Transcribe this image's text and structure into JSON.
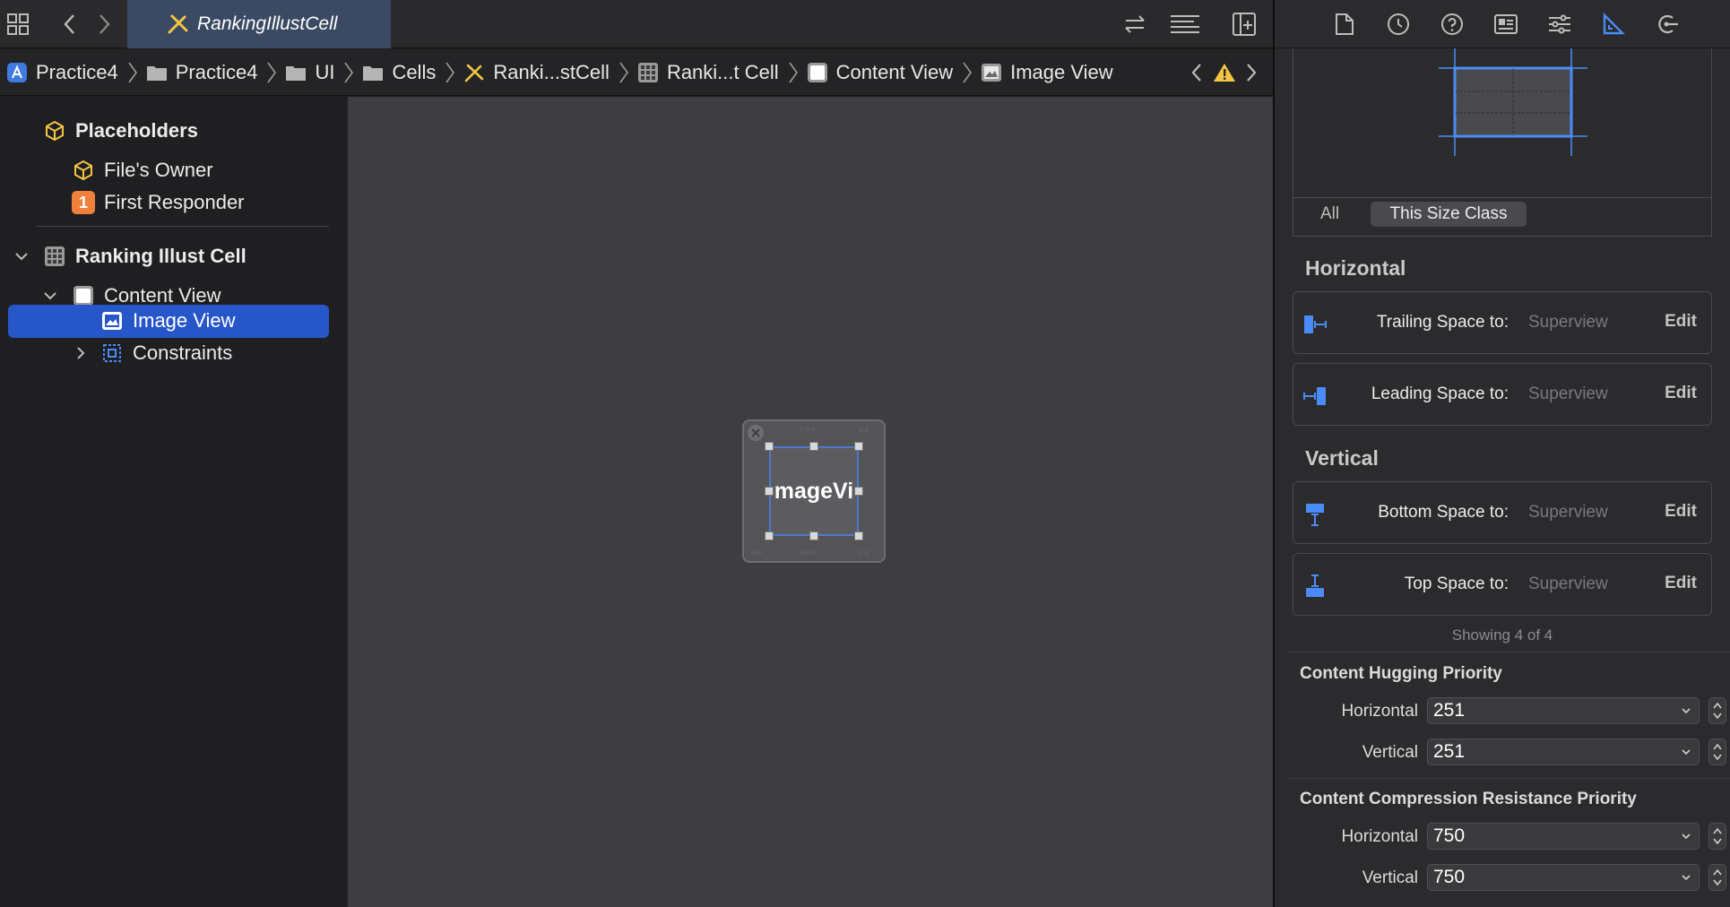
{
  "tab": {
    "title": "RankingIllustCell"
  },
  "breadcrumb": {
    "items": [
      {
        "label": "Practice4",
        "icon": "project-icon"
      },
      {
        "label": "Practice4",
        "icon": "folder-icon"
      },
      {
        "label": "UI",
        "icon": "folder-icon"
      },
      {
        "label": "Cells",
        "icon": "folder-icon"
      },
      {
        "label": "Ranki...stCell",
        "icon": "swift-file-icon"
      },
      {
        "label": "Ranki...t Cell",
        "icon": "collection-cell-icon"
      },
      {
        "label": "Content View",
        "icon": "view-icon"
      },
      {
        "label": "Image View",
        "icon": "image-view-icon"
      }
    ]
  },
  "navigator": {
    "placeholders": "Placeholders",
    "files_owner": "File's Owner",
    "first_responder": "First Responder",
    "first_responder_badge": "1",
    "cell": "Ranking Illust Cell",
    "content_view": "Content View",
    "image_view": "Image View",
    "constraints": "Constraints"
  },
  "canvas": {
    "image_view_text": "mageVi"
  },
  "inspector": {
    "segments": {
      "all": "All",
      "size_class": "This Size Class"
    },
    "horizontal_title": "Horizontal",
    "vertical_title": "Vertical",
    "constraints": [
      {
        "label": "Trailing Space to:",
        "target": "Superview",
        "edit": "Edit",
        "icon": "trailing-space-icon"
      },
      {
        "label": "Leading Space to:",
        "target": "Superview",
        "edit": "Edit",
        "icon": "leading-space-icon"
      },
      {
        "label": "Bottom Space to:",
        "target": "Superview",
        "edit": "Edit",
        "icon": "bottom-space-icon"
      },
      {
        "label": "Top Space to:",
        "target": "Superview",
        "edit": "Edit",
        "icon": "top-space-icon"
      }
    ],
    "showing": "Showing 4 of 4",
    "hugging": {
      "title": "Content Hugging Priority",
      "horizontal_label": "Horizontal",
      "horizontal_value": "251",
      "vertical_label": "Vertical",
      "vertical_value": "251"
    },
    "compression": {
      "title": "Content Compression Resistance Priority",
      "horizontal_label": "Horizontal",
      "horizontal_value": "750",
      "vertical_label": "Vertical",
      "vertical_value": "750"
    }
  },
  "colors": {
    "selection": "#2756c9",
    "accent": "#4a8cf7",
    "warning": "#f5c542",
    "badge": "#f0803c"
  }
}
